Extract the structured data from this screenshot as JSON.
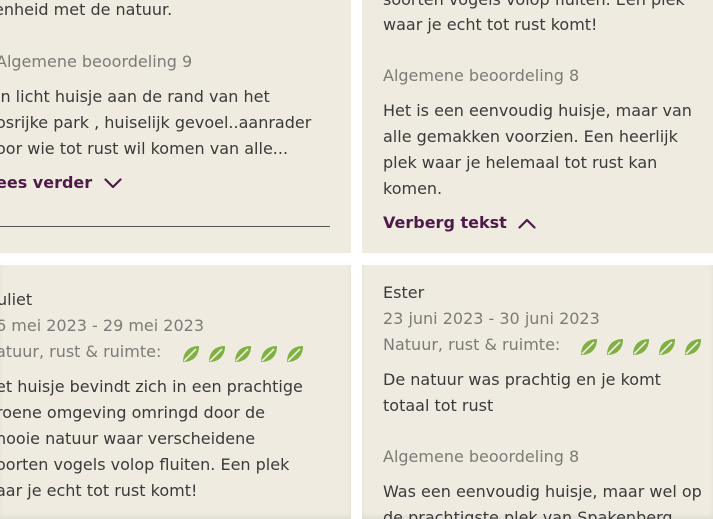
{
  "cards": {
    "top_left": {
      "text_tail": "enheid met de natuur.",
      "rating_label": "Algemene beoordeling 9",
      "review_text": "jn licht huisje aan de rand van het\nosrijke park , huiselijk gevoel..aanrader\noor wie tot rust wil komen van alle...",
      "toggle_label": "ees verder"
    },
    "top_right": {
      "text_tail": "waar je echt tot rust komt!",
      "rating_label": "Algemene beoordeling 8",
      "review_text": "Het is een eenvoudig huisje, maar van\nalle gemakken voorzien. Een heerlijk\nplek waar je helemaal tot rust kan\nkomen.",
      "toggle_label": "Verberg tekst"
    },
    "bottom_left": {
      "reviewer": "uliet",
      "dates": "6 mei 2023 - 29 mei 2023",
      "category_label": "atuur, rust & ruimte:",
      "leaf_score": 5,
      "review_text": "et huisje bevindt zich in een prachtige\nroene omgeving omringd door de\nnooie natuur waar verscheidene\noorten vogels volop fluiten. Een plek\naar je echt tot rust komt!"
    },
    "bottom_right": {
      "reviewer": "Ester",
      "dates": "23 juni 2023 - 30 juni 2023",
      "category_label": "Natuur, rust & ruimte:",
      "leaf_score": 5,
      "review_text": "De natuur was prachtig en je komt\ntotaal tot rust",
      "rating_label": "Algemene beoordeling 8",
      "review_text_2": "Was een eenvoudig huisje, maar wel op\nde prachtigste plek van Spakenberg"
    }
  },
  "colors": {
    "card_bg": "#efebe1",
    "link": "#4f1a4a",
    "leaf": "#7fb041",
    "muted_text": "#7d7b77"
  },
  "icons": {
    "leaf": "leaf-icon",
    "chevron_down": "chevron-down-icon",
    "chevron_up": "chevron-up-icon"
  }
}
